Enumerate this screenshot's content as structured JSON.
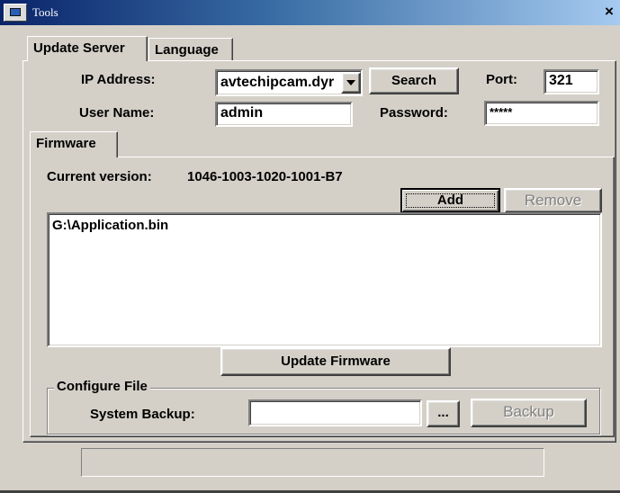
{
  "window": {
    "title": "Tools",
    "close_glyph": "×"
  },
  "tabs": {
    "update_server": "Update Server",
    "language": "Language"
  },
  "server": {
    "ip_label": "IP Address:",
    "ip_value": "avtechipcam.dyr",
    "search_button": "Search",
    "port_label": "Port:",
    "port_value": "321",
    "user_label": "User Name:",
    "user_value": "admin",
    "password_label": "Password:",
    "password_value": "*****"
  },
  "firmware": {
    "tab_label": "Firmware",
    "current_version_label": "Current version:",
    "current_version_value": "1046-1003-1020-1001-B7",
    "add_button": "Add",
    "remove_button": "Remove",
    "files": [
      "G:\\Application.bin"
    ],
    "update_button": "Update Firmware"
  },
  "configure": {
    "group_label": "Configure File",
    "system_backup_label": "System Backup:",
    "system_backup_value": "",
    "browse_button": "...",
    "backup_button": "Backup"
  },
  "statusbar": {
    "text": ""
  },
  "icons": {
    "window_icon": "tools-app-icon",
    "close_icon": "close-icon",
    "dropdown_icon": "chevron-down-icon"
  }
}
